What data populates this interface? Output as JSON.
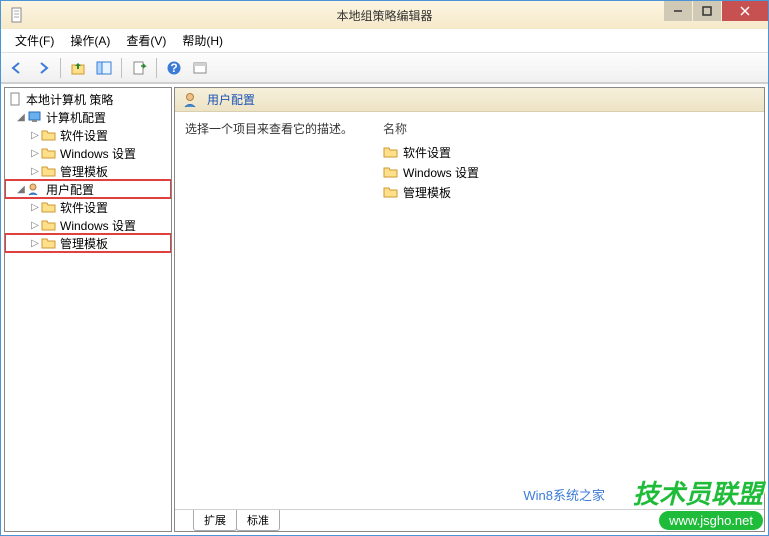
{
  "window": {
    "title": "本地组策略编辑器"
  },
  "menu": {
    "file": "文件(F)",
    "action": "操作(A)",
    "view": "查看(V)",
    "help": "帮助(H)"
  },
  "tree": {
    "root": "本地计算机 策略",
    "computer_config": "计算机配置",
    "cc_software": "软件设置",
    "cc_windows": "Windows 设置",
    "cc_admin": "管理模板",
    "user_config": "用户配置",
    "uc_software": "软件设置",
    "uc_windows": "Windows 设置",
    "uc_admin": "管理模板"
  },
  "right": {
    "header": "用户配置",
    "description": "选择一个项目来查看它的描述。",
    "col_name": "名称",
    "items": {
      "software": "软件设置",
      "windows": "Windows 设置",
      "admin": "管理模板"
    }
  },
  "tabs": {
    "extended": "扩展",
    "standard": "标准"
  },
  "watermark": {
    "line1": "技术员联盟",
    "line2": "www.jsgho.net",
    "line3": "Win8系统之家"
  }
}
